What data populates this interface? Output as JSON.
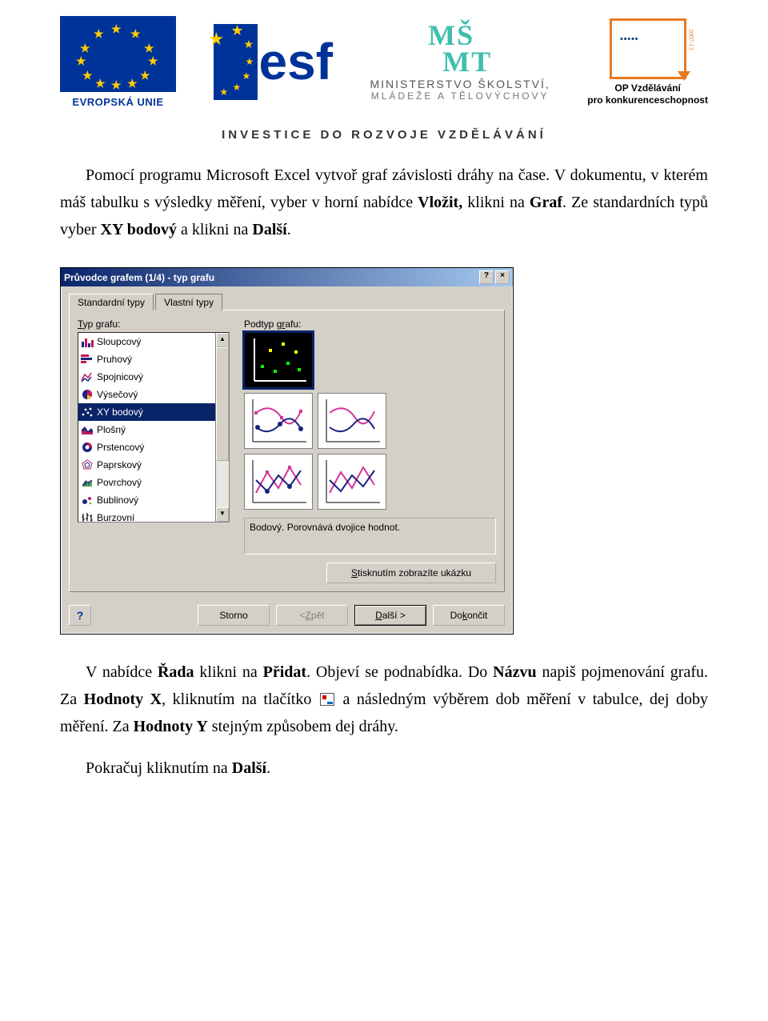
{
  "logos": {
    "eu_label": "EVROPSKÁ UNIE",
    "esf": "esf",
    "msmt_top": "MŠ",
    "msmt_bottom": "MT",
    "msmt_title": "MINISTERSTVO ŠKOLSTVÍ,",
    "msmt_sub": "MLÁDEŽE A TĚLOVÝCHOVY",
    "op_side": "2007-13",
    "op_title": "OP Vzdělávání",
    "op_sub": "pro konkurenceschopnost"
  },
  "banner": "INVESTICE DO ROZVOJE VZDĚLÁVÁNÍ",
  "p1": {
    "t0": "Pomocí programu Microsoft Excel vytvoř graf závislosti dráhy na čase. V dokumentu, v kterém máš tabulku s výsledky měření, vyber v horní nabídce ",
    "b1": "Vložit,",
    "t1": " klikni na ",
    "b2": "Graf",
    "t2": ". Ze standardních typů vyber ",
    "b3": "XY bodový",
    "t3": " a klikni na ",
    "b4": "Další",
    "t4": "."
  },
  "dialog": {
    "title": "Průvodce grafem (1/4) - typ grafu",
    "closeHelp": "?",
    "closeX": "×",
    "tabs": [
      "Standardní typy",
      "Vlastní typy"
    ],
    "typ_label": "Typ grafu:",
    "podtyp_label": "Podtyp grafu:",
    "chart_types": [
      "Sloupcový",
      "Pruhový",
      "Spojnicový",
      "Výsečový",
      "XY bodový",
      "Plošný",
      "Prstencový",
      "Paprskový",
      "Povrchový",
      "Bublinový",
      "Burzovní"
    ],
    "selected_index": 4,
    "desc": "Bodový. Porovnává dvojice hodnot.",
    "preview_btn": "Stisknutím zobrazíte ukázku",
    "help": "?",
    "storno": "Storno",
    "back": "< Zpět",
    "next": "Další >",
    "finish": "Dokončit"
  },
  "p2": {
    "t0": "V nabídce ",
    "b1": "Řada",
    "t1": " klikni na ",
    "b2": "Přidat",
    "t2": ". Objeví se podnabídka. Do ",
    "b3": "Názvu",
    "t3": " napiš pojmenování grafu. Za ",
    "b4": "Hodnoty X",
    "t4": ", kliknutím na tlačítko ",
    "t5": " a následným výběrem dob měření v tabulce, dej doby měření. Za ",
    "b5": "Hodnoty Y",
    "t6": " stejným způsobem dej dráhy."
  },
  "p3": {
    "t0": "Pokračuj kliknutím na ",
    "b1": "Další",
    "t1": "."
  }
}
